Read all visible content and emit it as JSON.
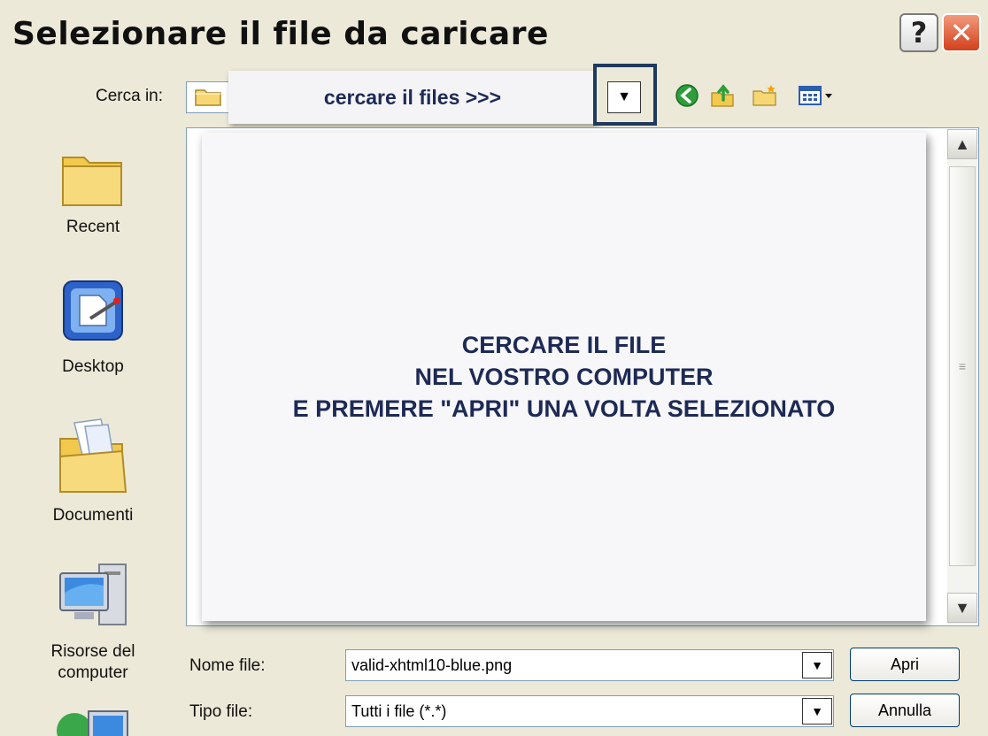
{
  "window": {
    "title": "Selezionare il file da caricare"
  },
  "titlebar": {
    "help_label": "?",
    "close_label": "✕"
  },
  "lookin": {
    "label": "Cerca in:",
    "callout": "cercare il files >>>",
    "dropdown_glyph": "▼"
  },
  "toolbar": {
    "icons": [
      "back-icon",
      "up-folder-icon",
      "new-folder-icon",
      "view-menu-icon"
    ]
  },
  "places": {
    "recent": "Recent",
    "desktop": "Desktop",
    "documents": "Documenti",
    "computer_line1": "Risorse del",
    "computer_line2": "computer"
  },
  "overlay": {
    "line1": "CERCARE IL FILE",
    "line2": "NEL VOSTRO COMPUTER",
    "line3": "E PREMERE \"APRI\" UNA VOLTA SELEZIONATO"
  },
  "filename": {
    "label": "Nome file:",
    "value": "valid-xhtml10-blue.png"
  },
  "filetype": {
    "label": "Tipo file:",
    "value": "Tutti i file (*.*)"
  },
  "buttons": {
    "open": "Apri",
    "cancel": "Annulla"
  },
  "colors": {
    "accent": "#1f3a5f",
    "close": "#d2401c",
    "dialog_bg": "#ece9d8",
    "callout_text": "#1d2a55"
  }
}
